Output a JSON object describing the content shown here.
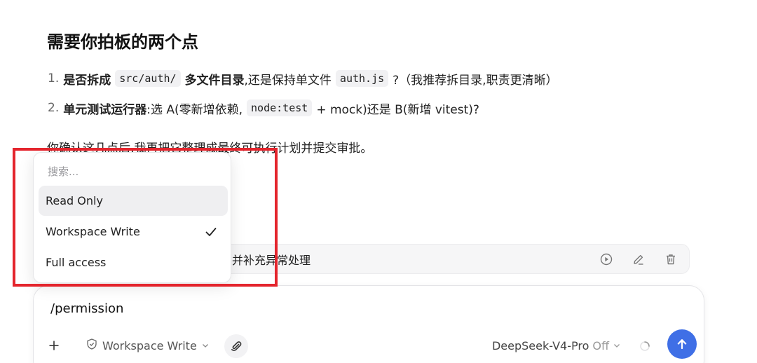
{
  "message": {
    "heading": "需要你拍板的两个点",
    "items": [
      {
        "num": "1.",
        "bold1": "是否拆成",
        "code1": "src/auth/",
        "bold2": "多文件目录",
        "text1": ",还是保持单文件",
        "code2": "auth.js",
        "text2": "?（我推荐拆目录,职责更清晰）"
      },
      {
        "num": "2.",
        "bold1": "单元测试运行器",
        "text1": ":选 A(零新增依赖,",
        "code1": "node:test",
        "text2": "+ mock)还是 B(新增 vitest)?"
      }
    ],
    "closing": "你确认这几点后,我再把它整理成最终可执行计划并提交审批。"
  },
  "queued_task": {
    "text": "并补充异常处理",
    "actions": [
      "play-icon",
      "edit-icon",
      "trash-icon"
    ]
  },
  "composer": {
    "input_text": "/permission",
    "permission_label": "Workspace Write",
    "model_name": "DeepSeek-V4-Pro",
    "model_mode": "Off"
  },
  "dropdown": {
    "search_placeholder": "搜索...",
    "options": [
      {
        "label": "Read Only",
        "hovered": true,
        "selected": false
      },
      {
        "label": "Workspace Write",
        "hovered": false,
        "selected": true
      },
      {
        "label": "Full access",
        "hovered": false,
        "selected": false
      }
    ]
  },
  "colors": {
    "accent": "#3f6fe6",
    "highlight": "#e4252d"
  }
}
